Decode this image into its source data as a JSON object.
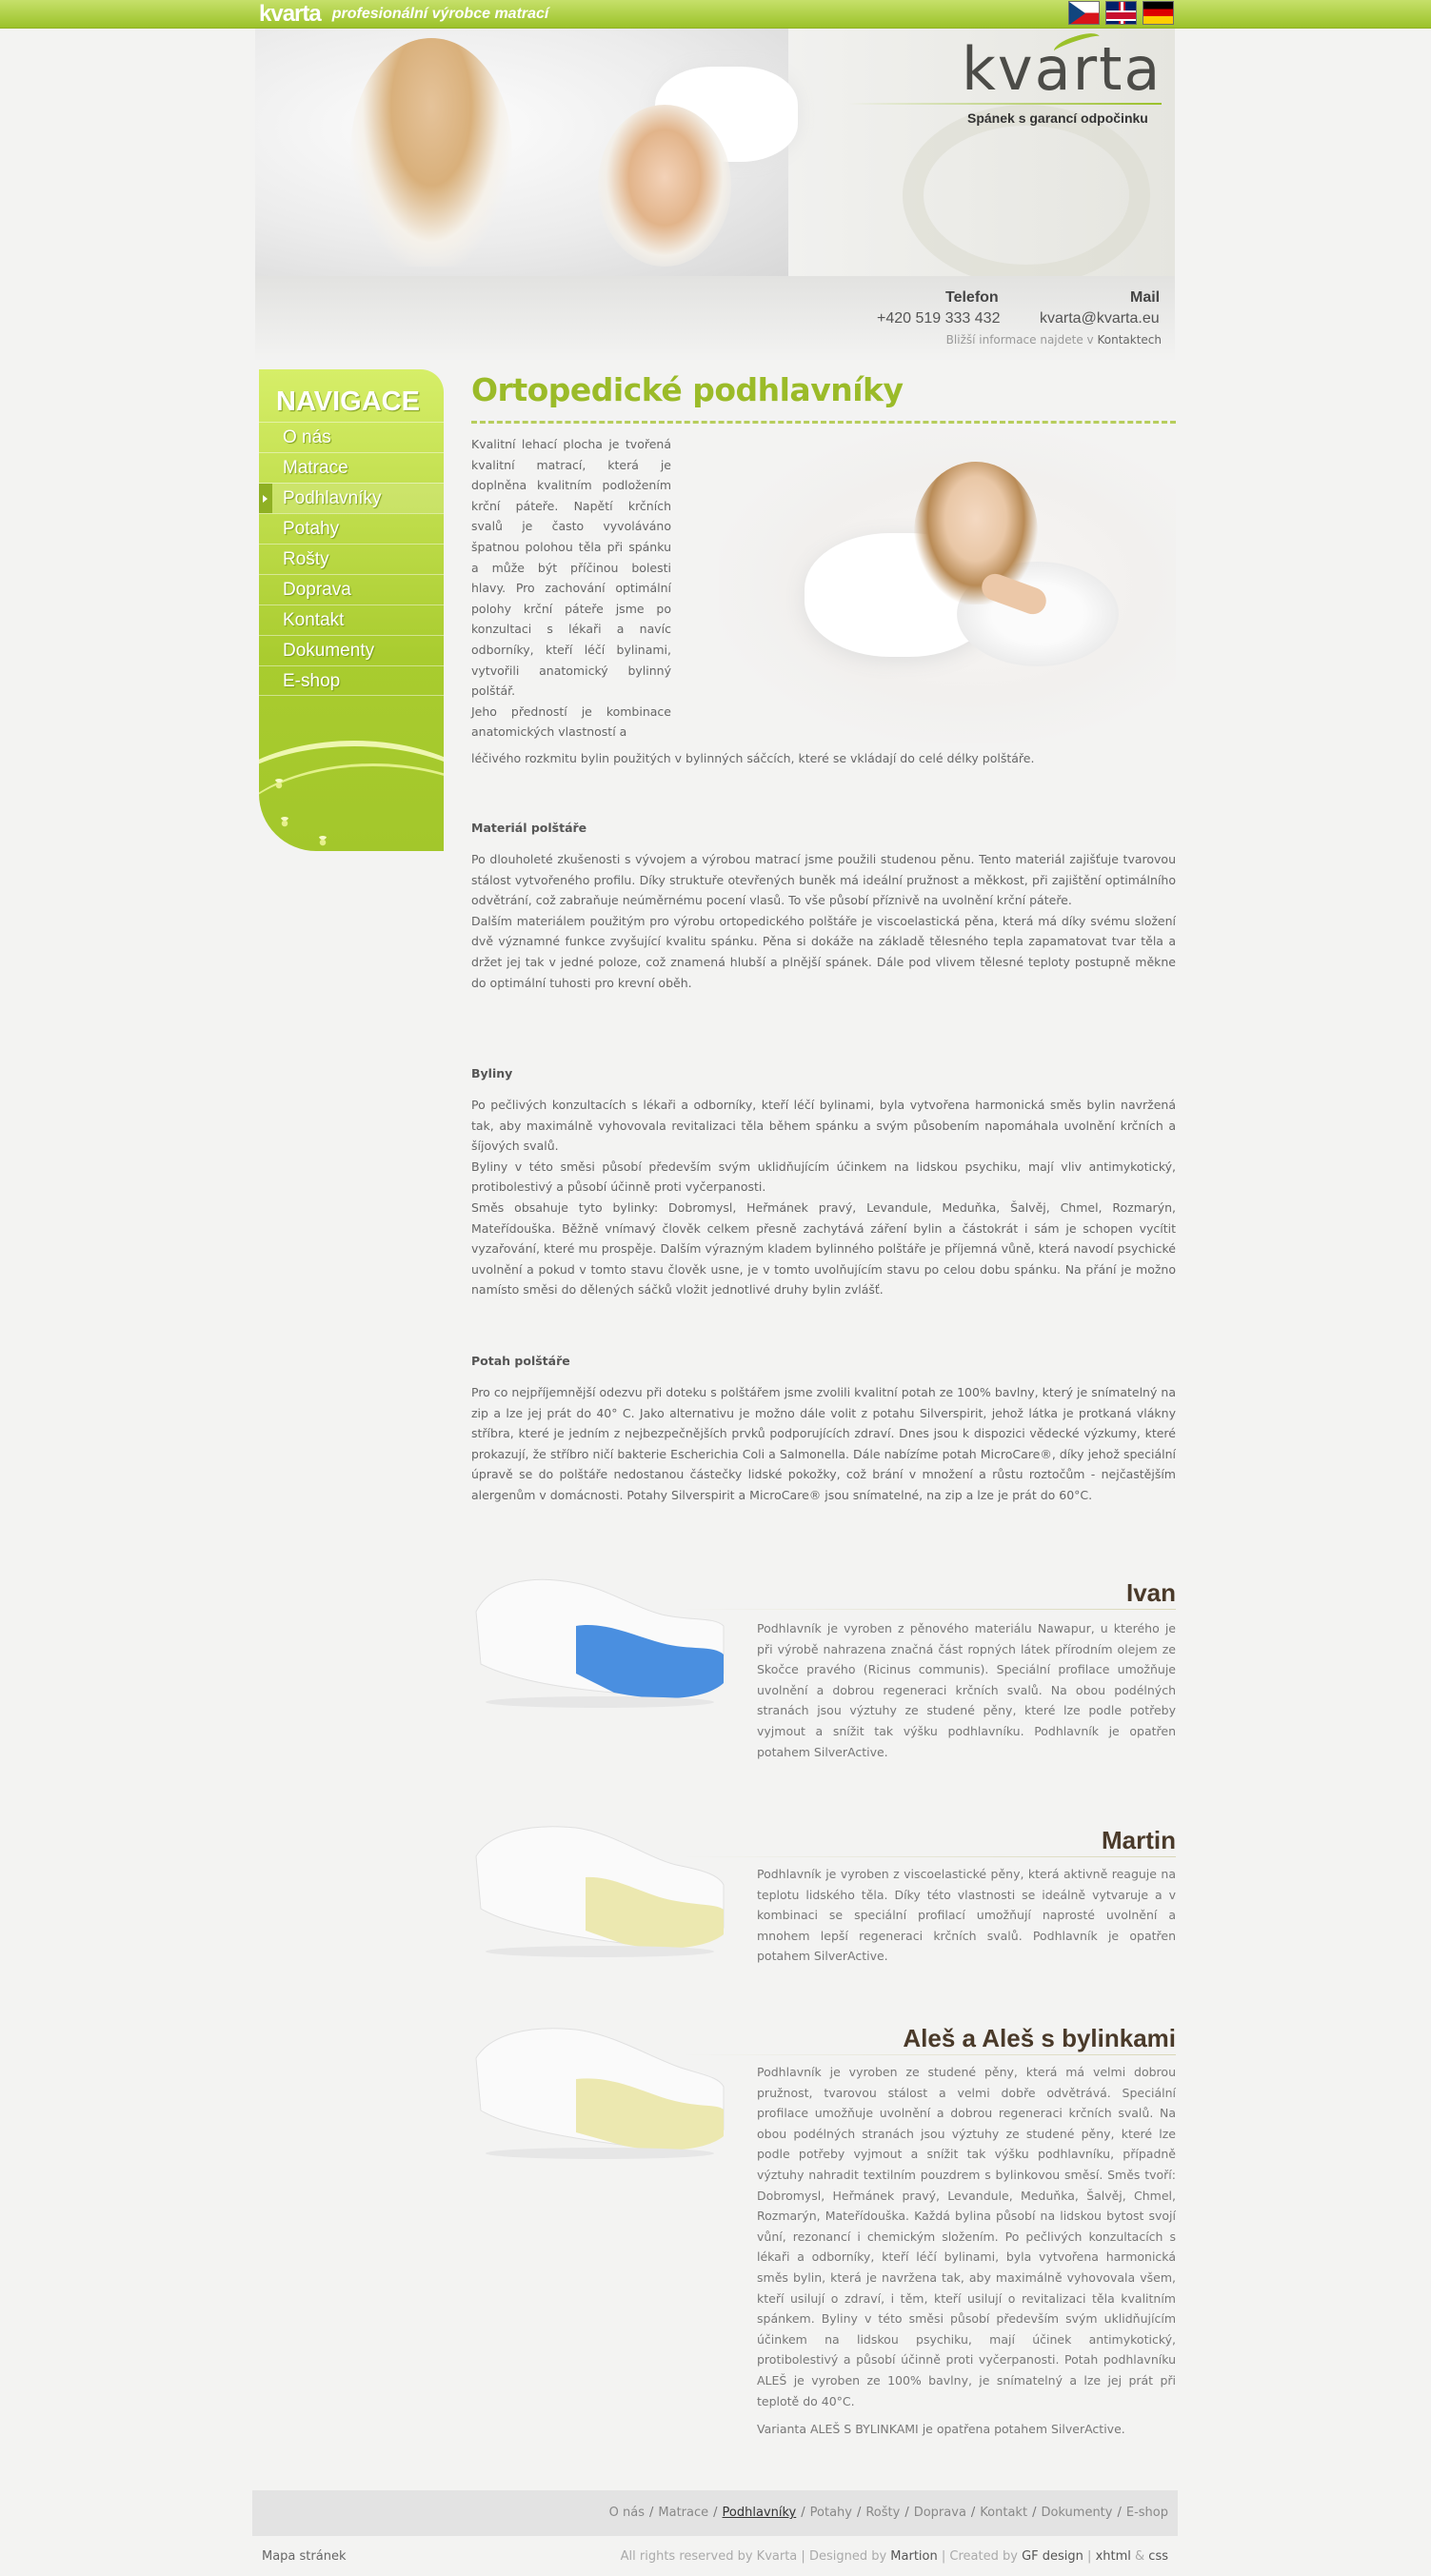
{
  "topbar": {
    "logo_text": "kvarta",
    "tagline": "profesionální výrobce matrací",
    "languages": [
      "cz-flag",
      "uk-flag",
      "de-flag"
    ]
  },
  "header": {
    "logo_word": "kvarta",
    "slogan": "Spánek s garancí odpočinku"
  },
  "contact": {
    "phone_label": "Telefon",
    "phone_value": "+420 519 333 432",
    "mail_label": "Mail",
    "mail_value": "kvarta@kvarta.eu",
    "more_prefix": "Bližší informace najdete v",
    "more_link": "Kontaktech"
  },
  "nav": {
    "title": "NAVIGACE",
    "items": [
      "O nás",
      "Matrace",
      "Podhlavníky",
      "Potahy",
      "Rošty",
      "Doprava",
      "Kontakt",
      "Dokumenty",
      "E-shop"
    ],
    "active_index": 2
  },
  "main": {
    "title": "Ortopedické podhlavníky",
    "intro": "Kvalitní lehací plocha je tvořená kvalitní matrací, která je doplněna kvalitním podložením krční páteře. Napětí krčních svalů je často vyvoláváno špatnou polohou těla při spánku a může být příčinou bolesti hlavy. Pro zachování optimální polohy krční páteře jsme po konzultaci s lékaři a navíc odborníky, kteří léčí bylinami, vytvořili anatomický bylinný polštář.",
    "intro2": "Jeho předností je kombinace anatomických vlastností a",
    "intro_tail": "léčivého rozkmitu bylin použitých v bylinných sáčcích, které se vkládají do celé délky polštáře.",
    "sections": [
      {
        "heading": "Materiál polštáře",
        "paragraphs": [
          "Po dlouholeté zkušenosti s vývojem a výrobou matrací jsme použili studenou pěnu. Tento materiál zajišťuje tvarovou stálost vytvořeného profilu. Díky struktuře otevřených buněk má ideální pružnost a měkkost, při zajištění optimálního odvětrání, což zabraňuje neúměrnému pocení vlasů. To vše působí příznivě na uvolnění krční páteře.",
          "Dalším materiálem použitým pro výrobu ortopedického polštáře je viscoelastická pěna, která má díky svému složení dvě významné funkce zvyšující kvalitu spánku. Pěna si dokáže na základě tělesného tepla zapamatovat tvar těla a držet jej tak v jedné poloze, což znamená hlubší a plnější spánek. Dále pod vlivem tělesné teploty postupně měkne do optimální tuhosti pro krevní oběh."
        ]
      },
      {
        "heading": "Byliny",
        "paragraphs": [
          "Po pečlivých konzultacích s lékaři a odborníky, kteří léčí bylinami, byla vytvořena harmonická směs bylin navržená tak, aby maximálně vyhovovala revitalizaci těla během spánku a svým působením napomáhala uvolnění krčních a šíjových svalů.",
          "Byliny v této směsi působí především svým uklidňujícím účinkem na lidskou psychiku, mají vliv antimykotický, protibolestivý a působí účinně proti vyčerpanosti.",
          "Směs obsahuje tyto bylinky: Dobromysl, Heřmánek pravý, Levandule, Meduňka, Šalvěj, Chmel, Rozmarýn, Mateřídouška. Běžně vnímavý člověk celkem přesně zachytává záření bylin a částokrát i sám je schopen vycítit vyzařování, které mu prospěje. Dalším výrazným kladem bylinného polštáře je příjemná vůně, která navodí psychické uvolnění a pokud v tomto stavu člověk usne, je v tomto uvolňujícím stavu po celou dobu spánku. Na přání je možno namísto směsi do dělených sáčků vložit jednotlivé druhy bylin zvlášť."
        ]
      },
      {
        "heading": "Potah polštáře",
        "paragraphs": [
          "Pro co nejpříjemnější odezvu při doteku s polštářem jsme zvolili kvalitní potah ze 100% bavlny, který je snímatelný na zip a lze jej prát do 40° C. Jako alternativu je možno dále volit z potahu Silverspirit, jehož látka je protkaná vlákny stříbra, které je jedním z nejbezpečnějších prvků podporujících zdraví. Dnes jsou k dispozici vědecké výzkumy, které prokazují, že stříbro ničí bakterie Escherichia Coli a Salmonella. Dále nabízíme potah MicroCare®, díky jehož speciální úpravě se do polštáře nedostanou částečky lidské pokožky, což brání v množení a růstu roztočům - nejčastějším alergenům v domácnosti. Potahy Silverspirit a MicroCare® jsou snímatelné, na zip a lze je prát do 60°C."
        ]
      }
    ],
    "products": [
      {
        "name": "Ivan",
        "insert_color": "#4a8fe0",
        "text": "Podhlavník je vyroben z pěnového materiálu Nawapur, u kterého je při výrobě nahrazena značná část ropných látek přírodním olejem ze Skočce pravého (Ricinus communis). Speciální profilace umožňuje uvolnění a dobrou regeneraci krčních svalů. Na obou podélných stranách jsou výztuhy ze studené pěny, které lze podle potřeby vyjmout a snížit tak výšku podhlavníku. Podhlavník je opatřen potahem SilverActive."
      },
      {
        "name": "Martin",
        "insert_color": "#ece8b0",
        "text": "Podhlavník je vyroben z viscoelastické pěny, která aktivně reaguje na teplotu lidského těla. Díky této vlastnosti se ideálně vytvaruje a v kombinaci se speciální profilací umožňují naprosté uvolnění a mnohem lepší regeneraci krčních svalů. Podhlavník je opatřen potahem SilverActive."
      },
      {
        "name": "Aleš a Aleš s bylinkami",
        "insert_color": "#ece8b0",
        "text": "Podhlavník je vyroben ze studené pěny, která má velmi dobrou pružnost, tvarovou stálost a velmi dobře odvětrává. Speciální profilace umožňuje uvolnění a dobrou regeneraci krčních svalů. Na obou podélných stranách jsou výztuhy ze studené pěny, které lze podle potřeby vyjmout a snížit tak výšku podhlavníku, případně výztuhy nahradit textilním pouzdrem s bylinkovou směsí. Směs tvoří: Dobromysl, Heřmánek pravý, Levandule, Meduňka, Šalvěj, Chmel, Rozmarýn, Mateřídouška. Každá bylina působí na lidskou bytost svojí vůní, rezonancí i chemickým složením. Po pečlivých konzultacích s lékaři a odborníky, kteří léčí bylinami, byla vytvořena harmonická směs bylin, která je navržena tak, aby maximálně vyhovovala všem, kteří usilují o zdraví, i těm, kteří usilují o revitalizaci těla kvalitním spánkem. Byliny v této směsi působí především svým uklidňujícím účinkem na lidskou psychiku, mají účinek antimykotický, protibolestivý a působí účinně proti vyčerpanosti. Potah podhlavníku ALEŠ je vyroben ze 100% bavlny, je snímatelný a lze jej prát při teplotě do 40°C.",
        "note": "Varianta ALEŠ S BYLINKAMI je opatřena potahem SilverActive."
      }
    ]
  },
  "footer": {
    "links": [
      "O nás",
      "Matrace",
      "Podhlavníky",
      "Potahy",
      "Rošty",
      "Doprava",
      "Kontakt",
      "Dokumenty",
      "E-shop"
    ],
    "current_index": 2,
    "sitemap": "Mapa stránek",
    "rights": "All rights reserved by Kvarta",
    "designed_by_label": "Designed by",
    "designed_by": "Martion",
    "created_by_label": "Created by",
    "created_by": "GF design",
    "xhtml": "xhtml",
    "amp": "&",
    "css": "css",
    "divider": "|",
    "link_separator": "/"
  },
  "colors": {
    "accent": "#9bbb29",
    "nav_green": "#a9cc2f",
    "topbar_green": "#9cc22a"
  }
}
